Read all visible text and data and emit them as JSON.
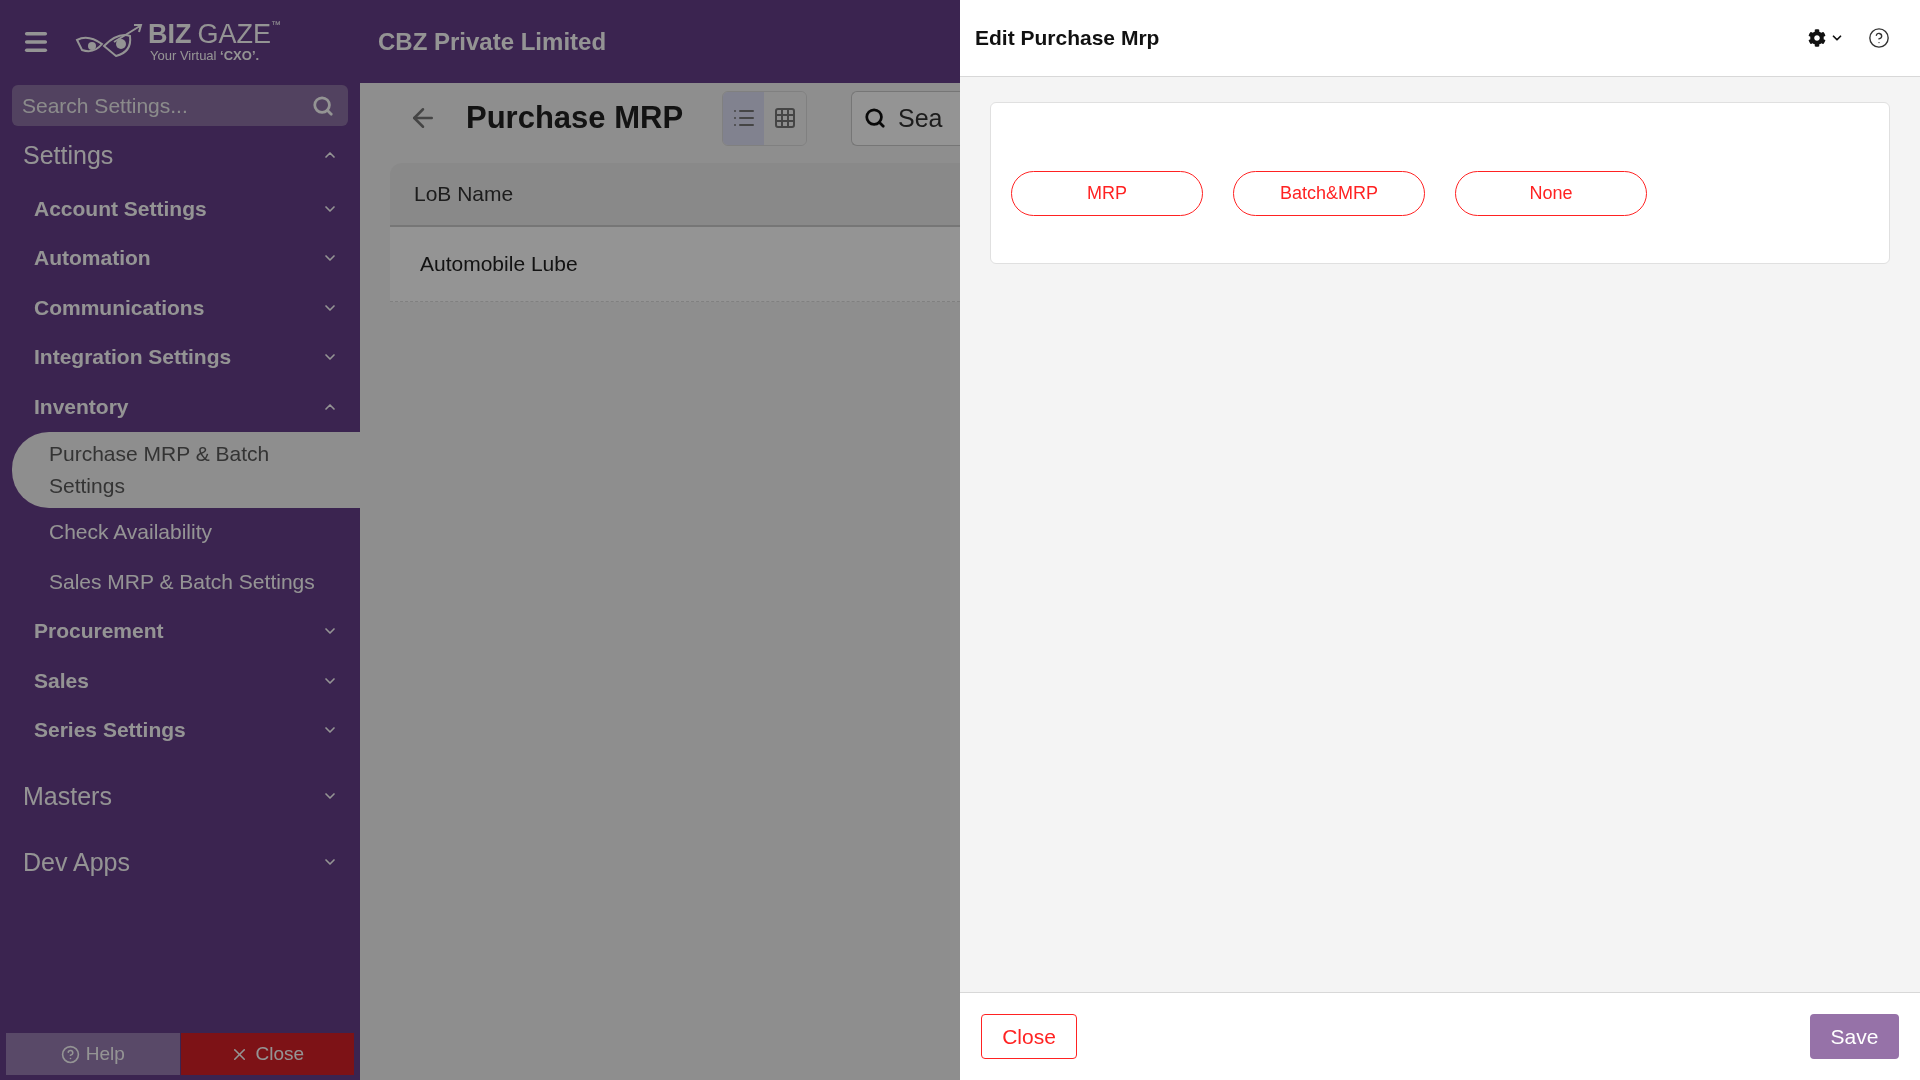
{
  "app_header": {
    "brand_bold": "BIZ",
    "brand_light": "GAZE",
    "trademark": "™",
    "tagline": "Your Virtual **‘CXO’.**",
    "company": "CBZ Private Limited"
  },
  "sidebar": {
    "search_placeholder": "Search Settings...",
    "sections": [
      {
        "label": "Settings",
        "expanded": true,
        "children": [
          {
            "label": "Account Settings",
            "expanded": false
          },
          {
            "label": "Automation",
            "expanded": false
          },
          {
            "label": "Communications",
            "expanded": false
          },
          {
            "label": "Integration Settings",
            "expanded": false
          },
          {
            "label": "Inventory",
            "expanded": true,
            "children": [
              {
                "label": "Purchase MRP & Batch Settings",
                "selected": true
              },
              {
                "label": "Check Availability",
                "selected": false
              },
              {
                "label": "Sales MRP & Batch Settings",
                "selected": false
              }
            ]
          },
          {
            "label": "Procurement",
            "expanded": false
          },
          {
            "label": "Sales",
            "expanded": false
          },
          {
            "label": "Series Settings",
            "expanded": false
          }
        ]
      },
      {
        "label": "Masters",
        "expanded": false
      },
      {
        "label": "Dev Apps",
        "expanded": false
      }
    ],
    "footer_buttons": [
      {
        "label": "Help",
        "kind": "help"
      },
      {
        "label": "Close",
        "kind": "close"
      }
    ]
  },
  "page": {
    "title": "Purchase MRP",
    "views": [
      {
        "kind": "list",
        "selected": true
      },
      {
        "kind": "grid",
        "selected": false
      }
    ],
    "search_placeholder": "Sea",
    "table": {
      "columns": [
        "LoB Name"
      ],
      "rows": [
        [
          "Automobile Lube"
        ]
      ]
    }
  },
  "drawer": {
    "title": "Edit Purchase Mrp",
    "options": [
      {
        "label": "MRP",
        "selected": false
      },
      {
        "label": "Batch&MRP",
        "selected": false
      },
      {
        "label": "None",
        "selected": false
      }
    ],
    "close_label": "Close",
    "save_label": "Save"
  }
}
